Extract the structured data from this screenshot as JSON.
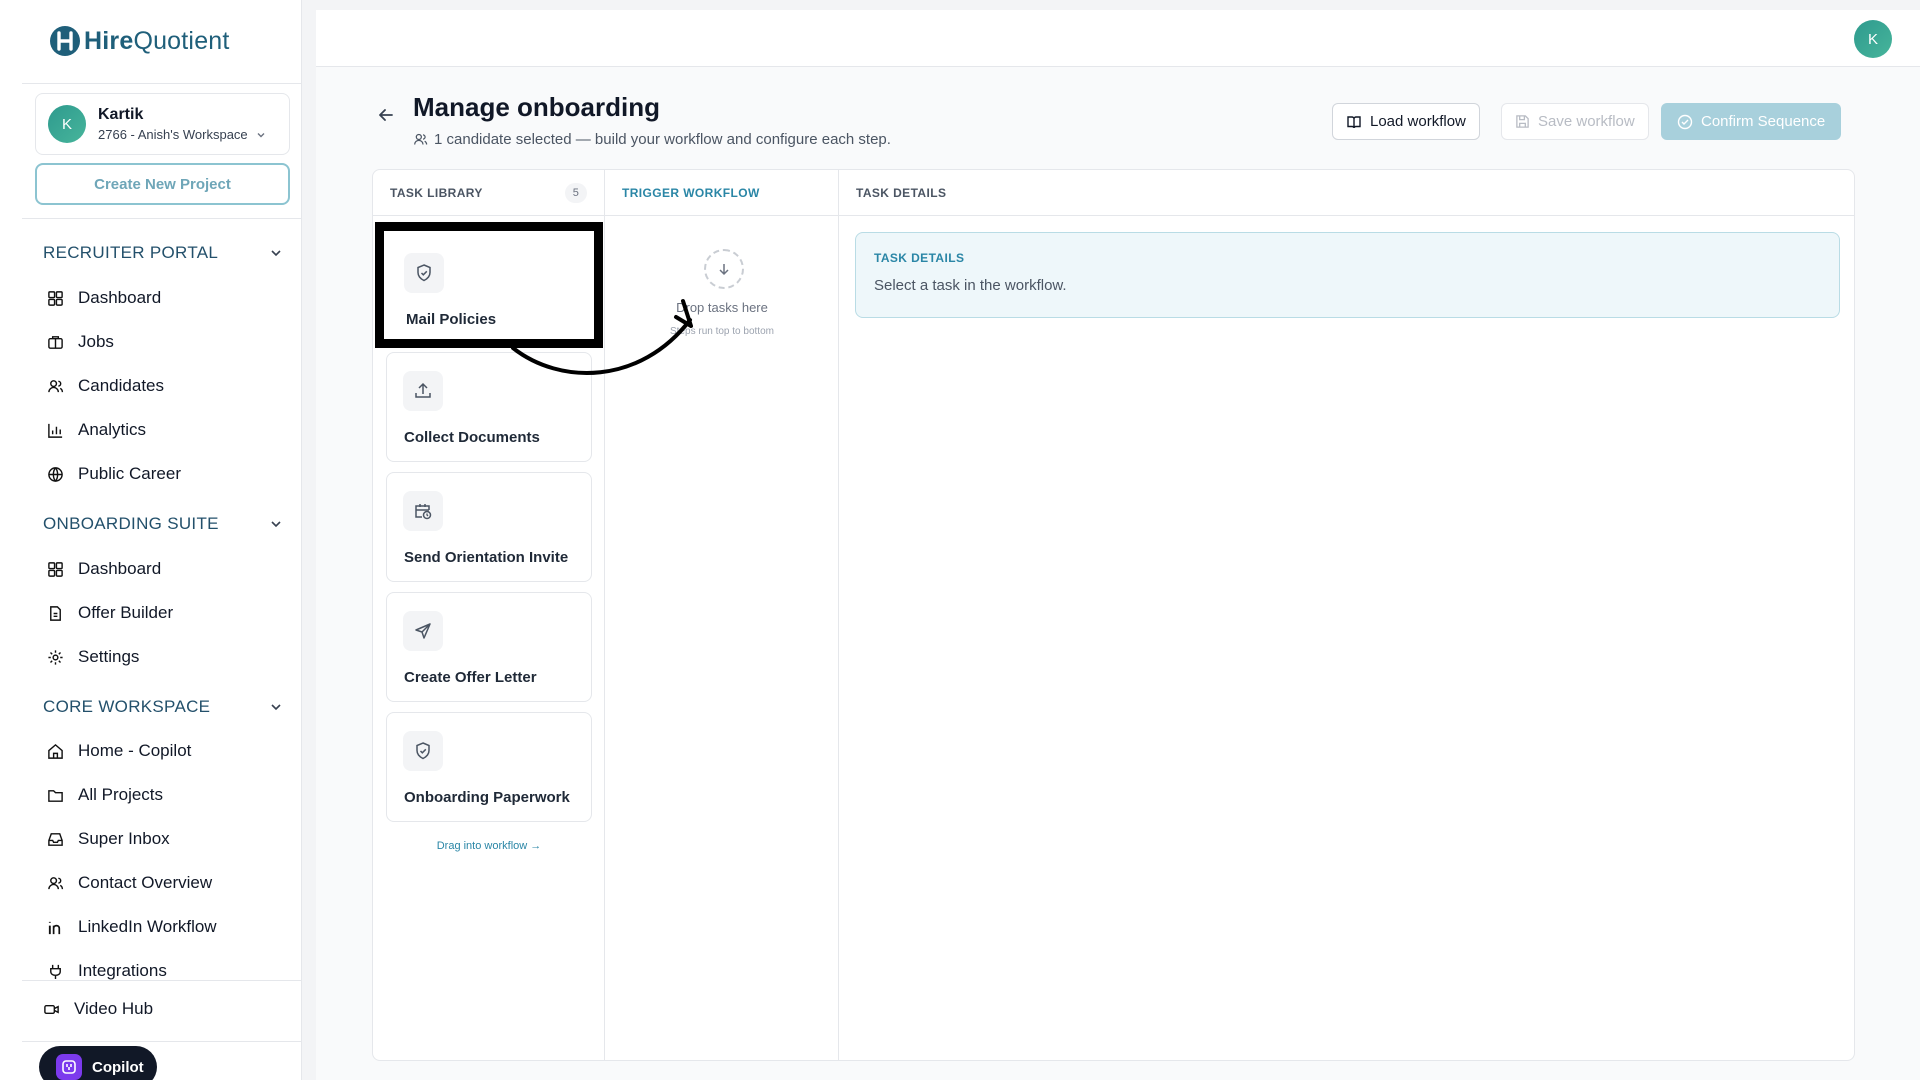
{
  "brand": {
    "name_bold": "Hire",
    "name_rest": "Quotient"
  },
  "workspace": {
    "user": "Kartik",
    "avatar_letter": "K",
    "workspace_name": "2766 - Anish's Workspace"
  },
  "sidebar": {
    "create_project": "Create New Project",
    "sections": [
      {
        "title": "RECRUITER PORTAL",
        "items": [
          {
            "label": "Dashboard",
            "icon": "dashboard-icon"
          },
          {
            "label": "Jobs",
            "icon": "briefcase-icon"
          },
          {
            "label": "Candidates",
            "icon": "users-icon"
          },
          {
            "label": "Analytics",
            "icon": "bar-chart-icon"
          },
          {
            "label": "Public Career",
            "icon": "globe-icon"
          }
        ]
      },
      {
        "title": "ONBOARDING SUITE",
        "items": [
          {
            "label": "Dashboard",
            "icon": "dashboard-icon"
          },
          {
            "label": "Offer Builder",
            "icon": "document-icon"
          },
          {
            "label": "Settings",
            "icon": "gear-icon"
          }
        ]
      },
      {
        "title": "CORE WORKSPACE",
        "items": [
          {
            "label": "Home - Copilot",
            "icon": "home-icon"
          },
          {
            "label": "All Projects",
            "icon": "folder-icon"
          },
          {
            "label": "Super Inbox",
            "icon": "inbox-icon"
          },
          {
            "label": "Contact Overview",
            "icon": "users-icon"
          },
          {
            "label": "LinkedIn Workflow",
            "icon": "linkedin-icon"
          },
          {
            "label": "Integrations",
            "icon": "plug-icon"
          }
        ]
      }
    ],
    "video_hub": "Video Hub",
    "copilot": "Copilot"
  },
  "header": {
    "avatar_letter": "K"
  },
  "page": {
    "title": "Manage onboarding",
    "subtitle": "1 candidate selected — build your workflow and configure each step.",
    "buttons": {
      "load": "Load workflow",
      "save": "Save workflow",
      "confirm": "Confirm Sequence"
    }
  },
  "library": {
    "header": "TASK LIBRARY",
    "count": "5",
    "tasks": [
      {
        "label": "Mail Policies",
        "icon": "shield-icon"
      },
      {
        "label": "Collect Documents",
        "icon": "upload-icon"
      },
      {
        "label": "Send Orientation Invite",
        "icon": "calendar-clock-icon"
      },
      {
        "label": "Create Offer Letter",
        "icon": "send-icon"
      },
      {
        "label": "Onboarding Paperwork",
        "icon": "shield-icon"
      }
    ],
    "drag_hint": "Drag into workflow →"
  },
  "trigger": {
    "header": "TRIGGER WORKFLOW",
    "drop_text": "Drop tasks here",
    "drop_sub": "Steps run top to bottom"
  },
  "details": {
    "header": "TASK DETAILS",
    "card_title": "TASK DETAILS",
    "card_text": "Select a task in the workflow."
  },
  "colors": {
    "brand": "#1f5f7a",
    "accent": "#2a86a6",
    "confirm_disabled": "#a8d0dc",
    "highlight_border": "#000000"
  }
}
